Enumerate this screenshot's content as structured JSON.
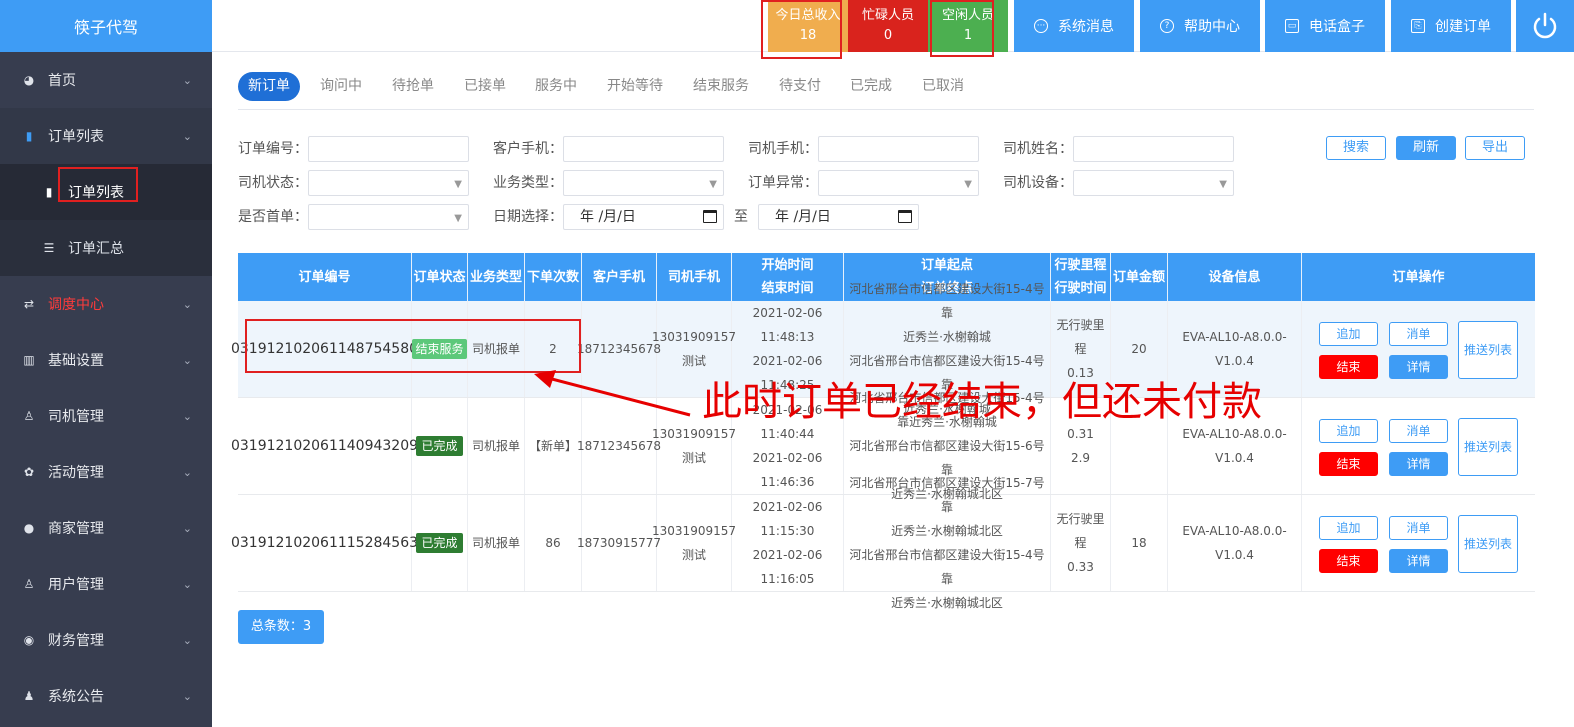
{
  "brand": "筷子代驾",
  "sidebar": {
    "items": [
      {
        "label": "首页",
        "icon": "dashboard-icon"
      },
      {
        "label": "订单列表",
        "icon": "clipboard-icon"
      },
      {
        "label": "订单列表",
        "icon": "clipboard-icon"
      },
      {
        "label": "订单汇总",
        "icon": "document-icon"
      },
      {
        "label": "调度中心",
        "icon": "dispatch-icon",
        "color": "#ff3b3b"
      },
      {
        "label": "基础设置",
        "icon": "buildings-icon"
      },
      {
        "label": "司机管理",
        "icon": "driver-icon"
      },
      {
        "label": "活动管理",
        "icon": "activity-icon"
      },
      {
        "label": "商家管理",
        "icon": "user-icon"
      },
      {
        "label": "用户管理",
        "icon": "user-icon"
      },
      {
        "label": "财务管理",
        "icon": "finance-icon"
      },
      {
        "label": "系统公告",
        "icon": "user-icon"
      }
    ]
  },
  "header": {
    "stats": [
      {
        "label": "今日总收入",
        "value": "18",
        "color": "#f0ad4e"
      },
      {
        "label": "忙碌人员",
        "value": "0",
        "color": "#d9231d"
      },
      {
        "label": "空闲人员",
        "value": "1",
        "color": "#4caf50"
      }
    ],
    "buttons": [
      "系统消息",
      "帮助中心",
      "电话盒子",
      "创建订单"
    ],
    "power_icon": "power-icon"
  },
  "tabs": [
    "新订单",
    "询问中",
    "待抢单",
    "已接单",
    "服务中",
    "开始等待",
    "结束服务",
    "待支付",
    "已完成",
    "已取消"
  ],
  "filters": {
    "order_no": "订单编号：",
    "customer_phone": "客户手机：",
    "driver_phone": "司机手机：",
    "driver_name": "司机姓名：",
    "driver_status": "司机状态：",
    "business_type": "业务类型：",
    "order_exception": "订单异常：",
    "driver_device": "司机设备：",
    "first_order": "是否首单：",
    "date_select": "日期选择：",
    "date_placeholder": "年 /月/日",
    "to": "至"
  },
  "actions": {
    "search": "搜索",
    "refresh": "刷新",
    "export": "导出"
  },
  "table": {
    "headers": {
      "order_no": "订单编号",
      "status": "订单状态",
      "biz_type": "业务类型",
      "count": "下单次数",
      "customer_phone": "客户手机",
      "driver_phone": "司机手机",
      "start_time": "开始时间",
      "end_time": "结束时间",
      "start_point": "订单起点",
      "end_point": "订单终点",
      "mileage": "行驶里程",
      "drive_time": "行驶时间",
      "amount": "订单金额",
      "device": "设备信息",
      "ops": "订单操作"
    },
    "rows": [
      {
        "order_no": "0319121020611487545​80",
        "status": "结束服务",
        "status_color": "#5cc87a",
        "biz_type": "司机报单",
        "count": "2",
        "customer_phone": "18712345678",
        "driver_phone": "13031909157",
        "driver_name": "测试",
        "start_time": "2021-02-06 11:48:13",
        "end_time": "2021-02-06 11:48:25",
        "start_line1": "河北省邢台市信都区建设大街15-4号靠",
        "start_line2": "近秀兰·水榭翰城",
        "end_line1": "河北省邢台市信都区建设大街15-4号靠",
        "end_line2": "近秀兰·水榭翰城",
        "mileage": "无行驶里程",
        "drive_time": "0.13",
        "amount": "20",
        "device": "EVA-AL10-A8.0.0-V1.0.4"
      },
      {
        "order_no": "031912102061140943209",
        "status": "已完成",
        "status_color": "#2e7d32",
        "biz_type": "司机报单",
        "count": "【新单】",
        "customer_phone": "18712345678",
        "driver_phone": "13031909157",
        "driver_name": "测试",
        "start_time": "2021-02-06 11:40:44",
        "end_time": "2021-02-06 11:46:36",
        "start_line1": "河北省邢台市信都区建设大街15-4号",
        "start_line2": "靠近秀兰·水榭翰城",
        "end_line1": "河北省邢台市信都区建设大街15-6号靠",
        "end_line2": "近秀兰·水榭翰城北区",
        "mileage": "0.31",
        "drive_time": "2.9",
        "amount": "",
        "device": "EVA-AL10-A8.0.0-V1.0.4"
      },
      {
        "order_no": "031912102061115284563",
        "status": "已完成",
        "status_color": "#2e7d32",
        "biz_type": "司机报单",
        "count": "86",
        "customer_phone": "18730915777",
        "driver_phone": "13031909157",
        "driver_name": "测试",
        "start_time": "2021-02-06 11:15:30",
        "end_time": "2021-02-06 11:16:05",
        "start_line1": "河北省邢台市信都区建设大街15-7号靠",
        "start_line2": "近秀兰·水榭翰城北区",
        "end_line1": "河北省邢台市信都区建设大街15-4号靠",
        "end_line2": "近秀兰·水榭翰城北区",
        "mileage": "无行驶里程",
        "drive_time": "0.33",
        "amount": "18",
        "device": "EVA-AL10-A8.0.0-V1.0.4"
      }
    ],
    "op_labels": {
      "add": "追加",
      "cancel": "消单",
      "end": "结束",
      "detail": "详情",
      "push": "推送列表"
    }
  },
  "total": "总条数：3",
  "annotation": "此时订单已经结束，但还未付款"
}
